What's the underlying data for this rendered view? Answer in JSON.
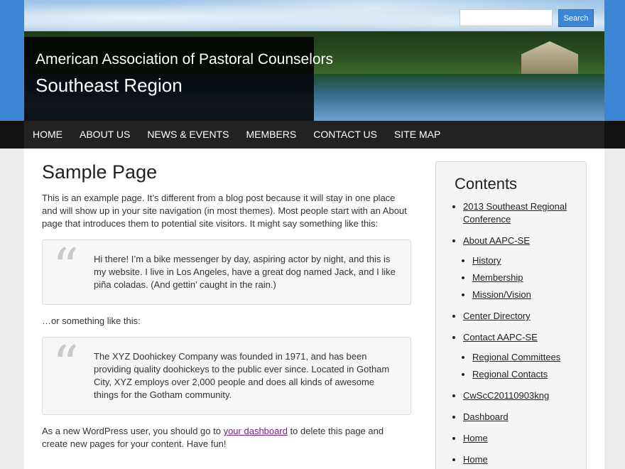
{
  "header": {
    "site_title": "American Association of Pastoral Counselors",
    "site_description": "Southeast Region",
    "search_button": "Search"
  },
  "nav": {
    "items": [
      "HOME",
      "ABOUT US",
      "NEWS & EVENTS",
      "MEMBERS",
      "CONTACT US",
      "SITE MAP"
    ]
  },
  "page": {
    "title": "Sample Page",
    "intro": "This is an example page. It’s different from a blog post because it will stay in one place and will show up in your site navigation (in most themes). Most people start with an About page that introduces them to potential site visitors. It might say something like this:",
    "quote1": "Hi there! I’m a bike messenger by day, aspiring actor by night, and this is my website. I live in Los Angeles, have a great dog named Jack, and I like piña coladas. (And gettin’ caught in the rain.)",
    "middle": "…or something like this:",
    "quote2": "The XYZ Doohickey Company was founded in 1971, and has been providing quality doohickeys to the public ever since. Located in Gotham City, XYZ employs over 2,000 people and does all kinds of awesome things for the Gotham community.",
    "outro_before": "As a new WordPress user, you should go to ",
    "outro_link": "your dashboard",
    "outro_after": " to delete this page and create new pages for your content. Have fun!"
  },
  "sidebar": {
    "title": "Contents",
    "items": [
      {
        "label": "2013 Southeast Regional Conference"
      },
      {
        "label": "About AAPC-SE",
        "children": [
          "History",
          "Membership",
          "Mission/Vision"
        ]
      },
      {
        "label": "Center Directory"
      },
      {
        "label": "Contact AAPC-SE",
        "children": [
          "Regional Committees",
          "Regional Contacts"
        ]
      },
      {
        "label": "CwScC20110903kng"
      },
      {
        "label": "Dashboard"
      },
      {
        "label": "Home"
      },
      {
        "label": "Home"
      }
    ]
  },
  "colors": {
    "accent": "#3d86d6",
    "navbar": "#222222",
    "link_visited": "#7a1f8a"
  }
}
